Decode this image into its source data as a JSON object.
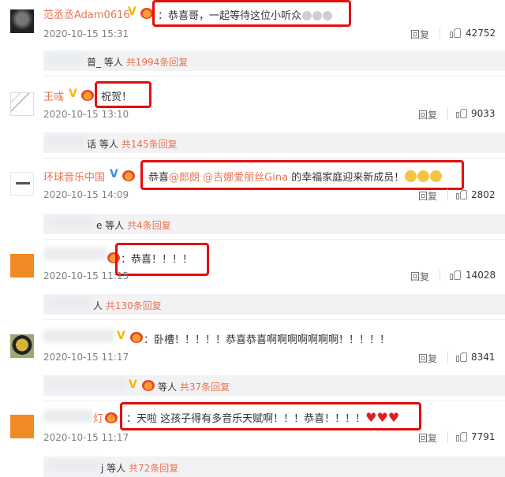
{
  "comments": [
    {
      "name": "范丞丞Adam0616",
      "text": "：恭喜哥，一起等待这位小听众",
      "time": "2020-10-15 15:31",
      "reply": "回复",
      "likes": "42752",
      "replies": {
        "name_tail": "普_",
        "suffix": "等人",
        "count_text": "共1994条回复"
      }
    },
    {
      "name": "王彧",
      "text": "祝贺！",
      "time": "2020-10-15 13:10",
      "reply": "回复",
      "likes": "9033",
      "replies": {
        "name_tail": "话",
        "suffix": "等人",
        "count_text": "共145条回复"
      }
    },
    {
      "name": "环球音乐中国",
      "text_parts": [
        "恭喜",
        "@郎朗",
        " ",
        "@吉娜爱丽丝Gina",
        " 的幸福家庭迎来新成员！"
      ],
      "time": "2020-10-15 14:09",
      "reply": "回复",
      "likes": "2802",
      "replies": {
        "name_tail": "e",
        "suffix": "等人",
        "count_text": "共4条回复"
      }
    },
    {
      "name": "",
      "text": "：恭喜！！！！",
      "time": "2020-10-15 11:15",
      "reply": "回复",
      "likes": "14028",
      "replies": {
        "name_tail": "人",
        "suffix": "",
        "count_text": "共130条回复"
      }
    },
    {
      "name": "",
      "text": "：卧槽！！！！！恭喜恭喜啊啊啊啊啊啊啊！！！！！",
      "time": "2020-10-15 11:17",
      "reply": "回复",
      "likes": "8341",
      "replies": {
        "name_tail": "",
        "suffix": "等人",
        "count_text": "共37条回复"
      }
    },
    {
      "name": "灯",
      "text": "：天啦 这孩子得有多音乐天赋啊！！！恭喜！！！！",
      "time": "2020-10-15 11:17",
      "reply": "回复",
      "likes": "7791",
      "replies": {
        "name_tail": "j",
        "suffix": "等人",
        "count_text": "共72条回复"
      }
    }
  ],
  "colors": {
    "username": "#eb7350",
    "highlight_box": "#e50d0d",
    "reply_bar": "#f2f2f5"
  },
  "icons": [
    "vip-gold-v",
    "vip-blue-v",
    "crown-badge",
    "thumbs-up",
    "smile-emoji",
    "heart-emoji"
  ]
}
